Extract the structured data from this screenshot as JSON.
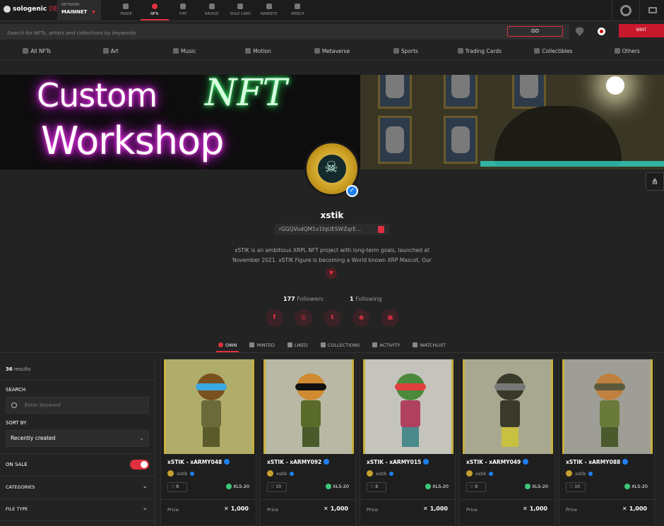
{
  "header": {
    "brand": "sologenic",
    "brand_suffix": "DEX",
    "network_label": "NETWORK",
    "network_value": "MAINNET",
    "nav": [
      {
        "label": "TRADE",
        "icon": "trade-icon"
      },
      {
        "label": "NFTs",
        "icon": "nft-icon",
        "active": true
      },
      {
        "label": "FIAT",
        "icon": "fiat-icon"
      },
      {
        "label": "BRIDGE",
        "icon": "bridge-icon"
      },
      {
        "label": "SOLO CARD",
        "icon": "card-icon"
      },
      {
        "label": "MARKETS",
        "icon": "markets-icon"
      },
      {
        "label": "MERCH",
        "icon": "merch-icon"
      }
    ]
  },
  "search": {
    "placeholder": "Search for NFTs, artists and collections by keywords",
    "go_label": "GO",
    "mint_label": "MINT"
  },
  "categories": [
    "All NFTs",
    "Art",
    "Music",
    "Motion",
    "Metaverse",
    "Sports",
    "Trading Cards",
    "Collectibles",
    "Others"
  ],
  "banner": {
    "line1": "Custom",
    "line2": "Workshop",
    "neon_script": "NFT"
  },
  "profile": {
    "name": "xstik",
    "address": "rGGQVudQM1v1tqUESWZqrE...",
    "description": "xSTIK is an ambitious XRPL NFT project with long-term goals, launched at November 2021. xSTIK Figure is becoming a World known XRP Mascot. Our",
    "followers_count": "177",
    "followers_label": "Followers",
    "following_count": "1",
    "following_label": "Following",
    "socials": [
      "f",
      "ig",
      "tw",
      "dc",
      "web"
    ]
  },
  "tabs": [
    "OWN",
    "MINTED",
    "LIKED",
    "COLLECTIONS",
    "ACTIVITY",
    "WATCHLIST"
  ],
  "sidebar": {
    "results_count": "36",
    "results_label": "results",
    "search_label": "SEARCH",
    "search_placeholder": "Enter keyword",
    "sort_label": "SORT BY",
    "sort_value": "Recently created",
    "onsale_label": "ON SALE",
    "categories_label": "CATEGORIES",
    "filetype_label": "FILE TYPE"
  },
  "nfts": [
    {
      "title": "xSTIK - xARMY048",
      "creator": "xstik",
      "likes": "8",
      "standard": "XLS-20",
      "price_label": "Price",
      "price": "1,000",
      "bg": "#b0ad6a"
    },
    {
      "title": "xSTIK - xARMY092",
      "creator": "xstik",
      "likes": "10",
      "standard": "XLS-20",
      "price_label": "Price",
      "price": "1,000",
      "bg": "#b8b8a4"
    },
    {
      "title": "xSTIK - xARMY015",
      "creator": "xstik",
      "likes": "8",
      "standard": "XLS-20",
      "price_label": "Price",
      "price": "1,000",
      "bg": "#c4c4bc"
    },
    {
      "title": "xSTIK - xARMY049",
      "creator": "xstik",
      "likes": "9",
      "standard": "XLS-20",
      "price_label": "Price",
      "price": "1,000",
      "bg": "#a8a890"
    },
    {
      "title": "xSTIK - xARMY088",
      "creator": "xstik",
      "likes": "10",
      "standard": "XLS-20",
      "price_label": "Price",
      "price": "1,000",
      "bg": "#9e9e96"
    }
  ],
  "colors": {
    "accent": "#e03040",
    "verified": "#1e80f0",
    "xls": "#3ec87a"
  }
}
